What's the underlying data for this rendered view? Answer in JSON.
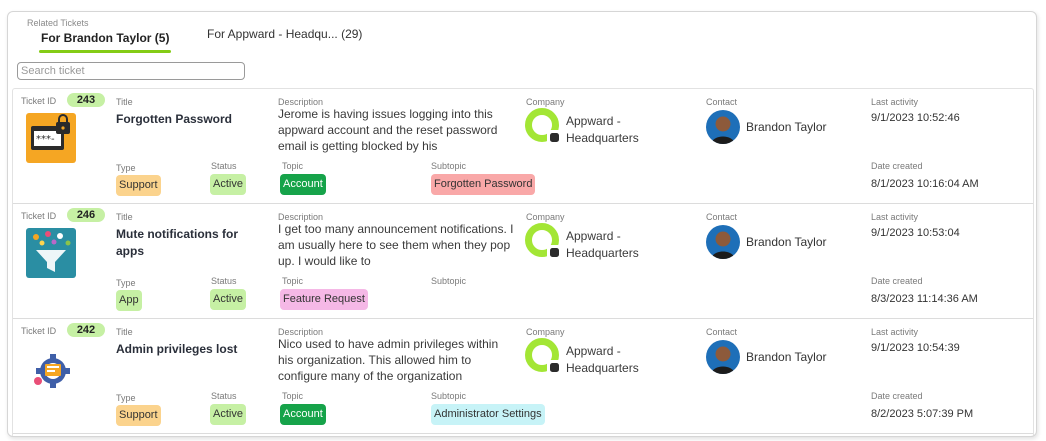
{
  "panel": {
    "legend": "Related Tickets"
  },
  "tabs": [
    {
      "label": "For Brandon Taylor (5)",
      "active": true
    },
    {
      "label": "For Appward - Headqu... (29)",
      "active": false
    }
  ],
  "search": {
    "placeholder": "Search ticket",
    "value": ""
  },
  "labels": {
    "ticket_id": "Ticket ID",
    "title": "Title",
    "description": "Description",
    "company": "Company",
    "contact": "Contact",
    "last_activity": "Last activity",
    "type": "Type",
    "status": "Status",
    "topic": "Topic",
    "subtopic": "Subtopic",
    "date_created": "Date created"
  },
  "colors": {
    "accent": "#84cc16",
    "topic_account": "#16a34a"
  },
  "tickets": [
    {
      "id": "243",
      "icon": "password-lock-icon",
      "title": "Forgotten Password",
      "description": "Jerome is having issues logging into this appward account and the reset password email is getting blocked by his",
      "company": "Appward - Headquarters",
      "contact": "Brandon Taylor",
      "last_activity": "9/1/2023 10:52:46",
      "type": "Support",
      "status": "Active",
      "topic": "Account",
      "subtopic": "Forgotten Password",
      "date_created": "8/1/2023 10:16:04 AM"
    },
    {
      "id": "246",
      "icon": "notification-funnel-icon",
      "title": "Mute notifications for apps",
      "description": "I get too many announcement notifications. I am usually here to see them when they pop up. I would like to",
      "company": "Appward - Headquarters",
      "contact": "Brandon Taylor",
      "last_activity": "9/1/2023 10:53:04",
      "type": "App",
      "status": "Active",
      "topic": "Feature Request",
      "subtopic": "",
      "date_created": "8/3/2023 11:14:36 AM"
    },
    {
      "id": "242",
      "icon": "admin-settings-icon",
      "title": "Admin privileges lost",
      "description": "Nico used to have admin privileges within his organization. This allowed him to configure many of the organization",
      "company": "Appward - Headquarters",
      "contact": "Brandon Taylor",
      "last_activity": "9/1/2023 10:54:39",
      "type": "Support",
      "status": "Active",
      "topic": "Account",
      "subtopic": "Administrator Settings",
      "date_created": "8/2/2023 5:07:39 PM"
    }
  ]
}
